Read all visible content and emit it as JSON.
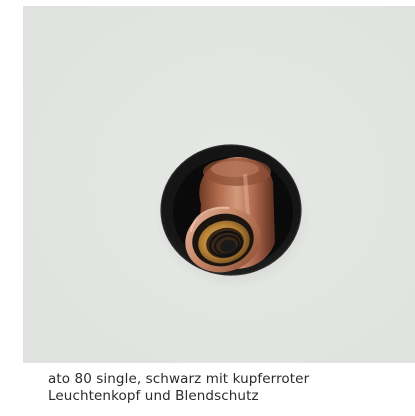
{
  "caption": {
    "line1": "ato 80 single, schwarz mit kupferroter",
    "line2": "Leuchtenkopf und Blendschutz"
  },
  "colors": {
    "background": "#e3e5e2",
    "trim": "#141414",
    "copper": "#b8775a",
    "text": "#2b2b2b"
  }
}
